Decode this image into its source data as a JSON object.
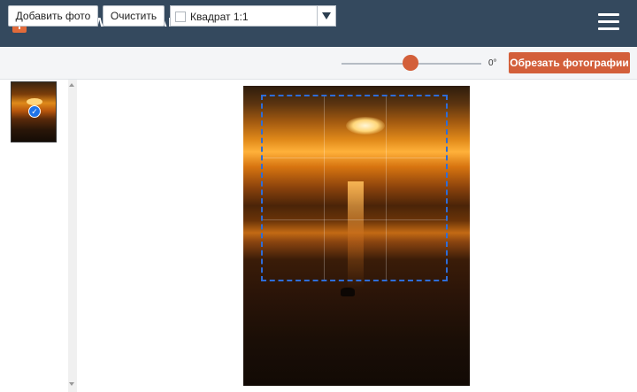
{
  "header": {
    "brand": "VISUAL WATERMARK",
    "logo_icon": "padlock-icon",
    "menu_icon": "hamburger-menu-icon",
    "background": "#34495e"
  },
  "toolbar": {
    "add_photo_label": "Добавить фото",
    "clear_label": "Очистить",
    "aspect_select": {
      "value": "Квадрат 1:1",
      "checked": false
    },
    "rotation": {
      "value_label": "0°",
      "slider_value_fraction": 0.5
    },
    "crop_button_label": "Обрезать фотографии",
    "accent": "#d35f3a"
  },
  "sidebar": {
    "thumbnails": [
      {
        "name": "sunset-thumbnail",
        "selected": true
      }
    ]
  },
  "main": {
    "image": "sunset-over-sea",
    "crop_ratio": "1:1"
  }
}
